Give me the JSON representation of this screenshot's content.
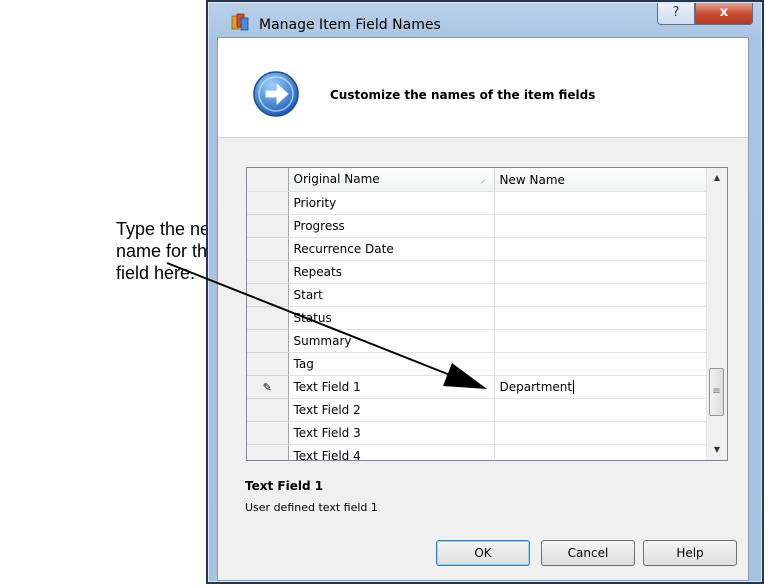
{
  "callout": {
    "line1": "Type the new",
    "line2": "name for the",
    "line3": "field here."
  },
  "window": {
    "title": "Manage Item Field Names",
    "help_glyph": "?",
    "close_glyph": "x"
  },
  "header": {
    "text": "Customize the names of the item fields",
    "icon": "arrow-right-circle-icon"
  },
  "grid": {
    "columns": {
      "original": "Original Name",
      "new": "New Name"
    },
    "rows": [
      {
        "original": "Priority",
        "new": ""
      },
      {
        "original": "Progress",
        "new": ""
      },
      {
        "original": "Recurrence Date",
        "new": ""
      },
      {
        "original": "Repeats",
        "new": ""
      },
      {
        "original": "Start",
        "new": ""
      },
      {
        "original": "Status",
        "new": ""
      },
      {
        "original": "Summary",
        "new": ""
      },
      {
        "original": "Tag",
        "new": ""
      },
      {
        "original": "Text Field 1",
        "new": "Department",
        "editing": true
      },
      {
        "original": "Text Field 2",
        "new": ""
      },
      {
        "original": "Text Field 3",
        "new": ""
      },
      {
        "original": "Text Field 4",
        "new": ""
      }
    ]
  },
  "description": {
    "title": "Text Field 1",
    "text": "User defined text field 1"
  },
  "buttons": {
    "ok": "OK",
    "cancel": "Cancel",
    "help": "Help"
  },
  "colors": {
    "title_bar": "#b9d1ea",
    "close_button": "#c7492f",
    "client_bg": "#f0f0f0",
    "header_icon": "#3a7fd0"
  }
}
